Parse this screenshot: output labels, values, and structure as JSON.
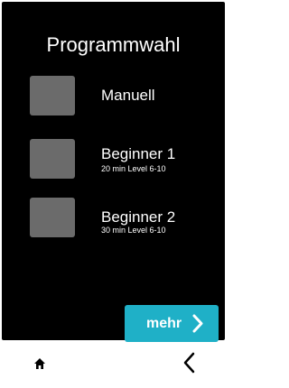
{
  "header": {
    "title": "Programmwahl"
  },
  "programs": [
    {
      "name": "Manuell",
      "details": ""
    },
    {
      "name": "Beginner 1",
      "details": "20 min  Level 6-10"
    },
    {
      "name": "Beginner 2",
      "details": "30 min Level 6-10"
    }
  ],
  "more_button": {
    "label": "mehr",
    "icon": "chevron-right-icon"
  },
  "navbar": {
    "home_icon": "home-icon",
    "back_icon": "chevron-left-icon"
  },
  "colors": {
    "background": "#000000",
    "accent": "#1fb0c7",
    "thumbnail": "#6b6b6b",
    "text": "#ffffff"
  }
}
